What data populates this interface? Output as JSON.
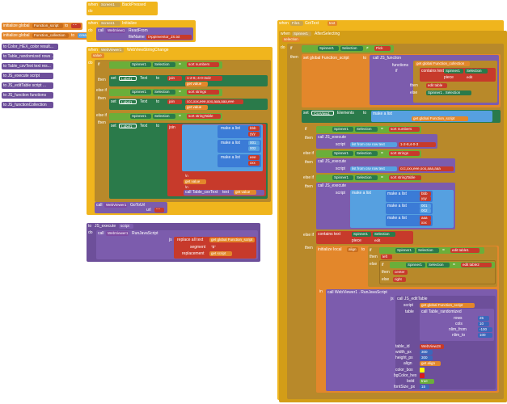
{
  "colors": {
    "event": "#f0b51d",
    "variable": "#e3872b",
    "procedure": "#6d4f9a",
    "text": "#c73a2b",
    "list": "#56a0e0",
    "control": "#b8892a",
    "math": "#3c67bb",
    "component": "#2a7a4a"
  },
  "left_collapsed": {
    "init_script": {
      "prefix": "initialize global",
      "name": "Function_script",
      "to": "to",
      "val": "\" \""
    },
    "init_collection": {
      "prefix": "initialize global",
      "name": "Function_collection",
      "to": "to",
      "val": "create empty list"
    },
    "procs": [
      "to Color_HEX_color result...",
      "to Table_randomized rows ...",
      "to Table_csvText text res...",
      "to JS_execute script",
      "to JS_editTable script ...",
      "to JS_function functions",
      "to JS_functionCollection"
    ]
  },
  "back_pressed": {
    "when": "when",
    "comp": "Screen1",
    "evt": "BackPressed",
    "do": "do"
  },
  "init_screen": {
    "when": "when",
    "comp": "Screen1",
    "evt": "Initialize",
    "do": "do",
    "call": "call",
    "comp2": "WebView1",
    "method": "ReadFrom",
    "arg": "fileName",
    "val": "/AppInventor_JS.txt"
  },
  "webview_change": {
    "when": "when",
    "comp": "WebViewer1",
    "evt": "WebViewStringChange",
    "value": "value",
    "if": "if",
    "then": "then",
    "elseif": "else if",
    "cond1": {
      "comp": "Spinner1",
      "prop": "Selection",
      "op": "=",
      "val": "sort numbers"
    },
    "cond2": {
      "comp": "Spinner1",
      "prop": "Selection",
      "op": "=",
      "val": "sort strings"
    },
    "cond3": {
      "comp": "Spinner1",
      "prop": "Selection",
      "op": "=",
      "val": "sort stringTable"
    },
    "set1": {
      "set": "set",
      "comp": "Label1",
      "prop": "Text",
      "to": "to",
      "join": "join",
      "items": [
        "1-2-8,-4-0-3x/2",
        "get value"
      ]
    },
    "set2": {
      "set": "set",
      "comp": "Label1",
      "prop": "Text",
      "to": "to",
      "join": "join",
      "items": [
        "ccc,xxx,eee,ooo,aaa,aaa,eee",
        "get value"
      ]
    },
    "set3": {
      "set": "set",
      "comp": "Label1",
      "prop": "Text",
      "to": "to",
      "join": "join",
      "make": "make a list",
      "list_a": [
        "bbb",
        "yyy"
      ],
      "list_b": [
        "001",
        "002"
      ],
      "list_c": [
        "eee",
        "xxx"
      ],
      "tail": [
        "\\n",
        "get value",
        "\\n"
      ],
      "csv": "call Table_csvText",
      "csv_text": "text",
      "csv_val": "get value"
    },
    "goto": {
      "call": "call",
      "comp": "WebViewer1",
      "method": "GoToUrl",
      "arg": "url",
      "val": "\" \""
    }
  },
  "js_execute": {
    "to": "to",
    "name": "JS_execute",
    "param": "script",
    "do": "do",
    "call": "call",
    "comp": "WebViewer1",
    "method": "RunJavaScript",
    "js": "js",
    "replace": "replace all text",
    "get_script": "get global Function_script",
    "segment": "segment",
    "seg_val": "\"$\"",
    "replacement": "replacement",
    "get_val": "get script"
  },
  "after_selecting": {
    "when": "when",
    "comp": "Spinner1",
    "evt": "AfterSelecting",
    "selection": "selection",
    "do": "do",
    "if": "if",
    "then": "then",
    "elseif": "else if",
    "cond0": {
      "comp": "Spinner1",
      "prop": "Selection",
      "op": "≠",
      "val": "Pick"
    },
    "set_script": {
      "set": "set global Function_script",
      "to": "to",
      "call": "call JS_function",
      "functions": "functions",
      "get_coll": "get global Function_collection",
      "contains": "contains text",
      "comp": "Spinner1",
      "prop": "Selection",
      "piece": "piece",
      "piece_val": "edit",
      "edit": "edit table",
      "else": "else",
      "else_get": "Spinner1 . Selection"
    },
    "set_view": {
      "set": "set",
      "comp": "CsvView1",
      "prop": "Elements",
      "to": "to",
      "make": "make a list",
      "get_script": "get global Function_script"
    },
    "c1": {
      "comp": "Spinner1",
      "prop": "Selection",
      "op": "=",
      "val": "sort numbers",
      "call": "call JS_execute",
      "script": "script",
      "listcsv": "list from csv row text",
      "text": "1-2-8,4-0-3"
    },
    "c2": {
      "comp": "Spinner1",
      "prop": "Selection",
      "op": "=",
      "val": "sort strings",
      "call": "call JS_execute",
      "script": "script",
      "listcsv": "list from csv row text",
      "text": "ccc,xxx,eee,ooo,aaa,aaa"
    },
    "c3": {
      "comp": "Spinner1",
      "prop": "Selection",
      "op": "=",
      "val": "sort stringTable",
      "call": "call JS_execute",
      "script": "script",
      "make": "make a list",
      "l1": [
        "bbb",
        "yyy"
      ],
      "l2": [
        "001",
        "002"
      ],
      "l3": [
        "aaa",
        "xxx"
      ]
    },
    "c4": {
      "contains": "contains text",
      "comp": "Spinner1",
      "prop": "Selection",
      "piece": "piece",
      "piece_val": "edit",
      "init_local": "initialize local",
      "align": "align",
      "to": "to",
      "if": "if",
      "then": "then",
      "else": "else",
      "a_comp": "Spinner1",
      "a_prop": "Selection",
      "a_op": "=",
      "a_val": "edit table1",
      "a_then": "left",
      "b_comp": "Spinner1",
      "b_prop": "Selection",
      "b_op": "=",
      "b_val": "edit table2",
      "b_then": "center",
      "b_else": "right",
      "in": "in",
      "call": "call WebViewer1 . RunJavaScript",
      "js": "js",
      "call_edit": "call JS_editTable",
      "script": "script",
      "get_script": "get global Function_script",
      "table": "table",
      "call_rand": "call Table_randomized",
      "rows": "rows",
      "rows_v": "25",
      "cols": "cols",
      "cols_v": "10",
      "nfrom": "nlim_from",
      "nfrom_v": "-100",
      "nto": "nlim_to",
      "nto_v": "100",
      "table_id": "table_id",
      "table_id_v": "WebViewJS",
      "width_px": "width_px",
      "width_v": "300",
      "height_px": "height_px",
      "height_v": "300",
      "align_l": "align",
      "align_v": "get align",
      "color_box": "color_box",
      "bgcolor": "bgColor_hex",
      "bold": "bold",
      "bold_v": "true",
      "fontsize": "fontSize_px",
      "fontsize_v": "15"
    }
  },
  "fileset_event": {
    "when": "when",
    "comp": "File1",
    "evt": "GotText",
    "param": "text"
  }
}
